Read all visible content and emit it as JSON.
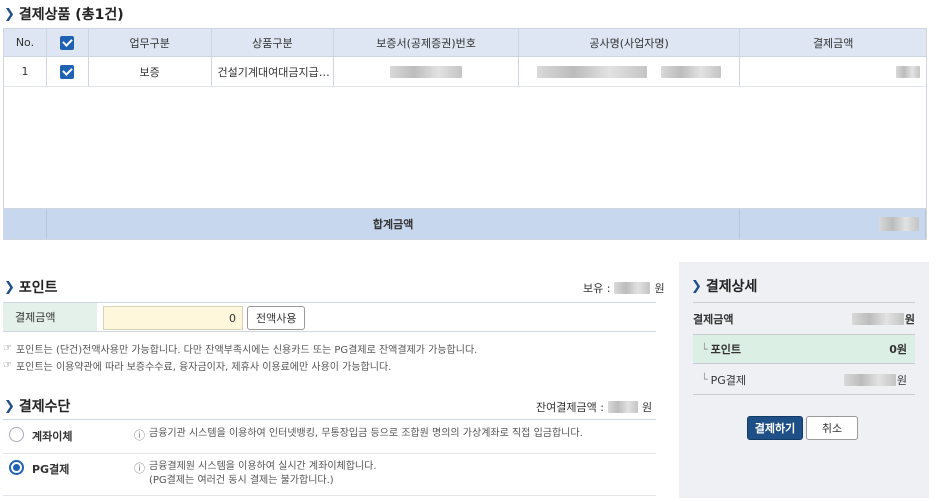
{
  "products": {
    "title": "결제상품 (총1건)",
    "columns": [
      "No.",
      "",
      "업무구분",
      "상품구분",
      "보증서(공제증권)번호",
      "공사명(사업자명)",
      "결제금액"
    ],
    "rows": [
      {
        "no": "1",
        "checked": true,
        "business": "보증",
        "product": "건설기계대여대금지급…"
      }
    ],
    "total_label": "합계금액"
  },
  "point": {
    "title": "포인트",
    "owned_label": "보유 :",
    "owned_unit": "원",
    "amount_label": "결제금액",
    "amount_value": "0",
    "use_all_button": "전액사용",
    "notes": [
      "포인트는 (단건)전액사용만 가능합니다. 다만 잔액부족시에는 신용카드 또는 PG결제로 잔액결제가 가능합니다.",
      "포인트는 이용약관에 따라 보증수수료, 융자금이자, 제휴사 이용료에만 사용이 가능합니다."
    ]
  },
  "payment_method": {
    "title": "결제수단",
    "remaining_label": "잔여결제금액 :",
    "remaining_unit": "원",
    "options": [
      {
        "label": "계좌이체",
        "selected": false,
        "desc": [
          "금융기관 시스템을 이용하여 인터넷뱅킹, 무통장입금 등으로 조합원 명의의 가상계좌로 직접 입금합니다."
        ]
      },
      {
        "label": "PG결제",
        "selected": true,
        "desc": [
          "금융결제원 시스템을 이용하여 실시간 계좌이체합니다.",
          "(PG결제는 여러건 동시 결제는 불가합니다.)"
        ]
      }
    ]
  },
  "detail": {
    "title": "결제상세",
    "amount_label": "결제금액",
    "amount_unit": "원",
    "point_label": "포인트",
    "point_value": "0",
    "point_unit": "원",
    "pg_label": "PG결제",
    "pg_unit": "원",
    "pay_button": "결제하기",
    "cancel_button": "취소"
  },
  "colors": {
    "accent": "#1f4e8c",
    "header_bg": "#dde6f2",
    "footer_bg": "#c7d7ee",
    "label_green": "#e4f1ea",
    "input_yellow": "#fff7dc"
  }
}
